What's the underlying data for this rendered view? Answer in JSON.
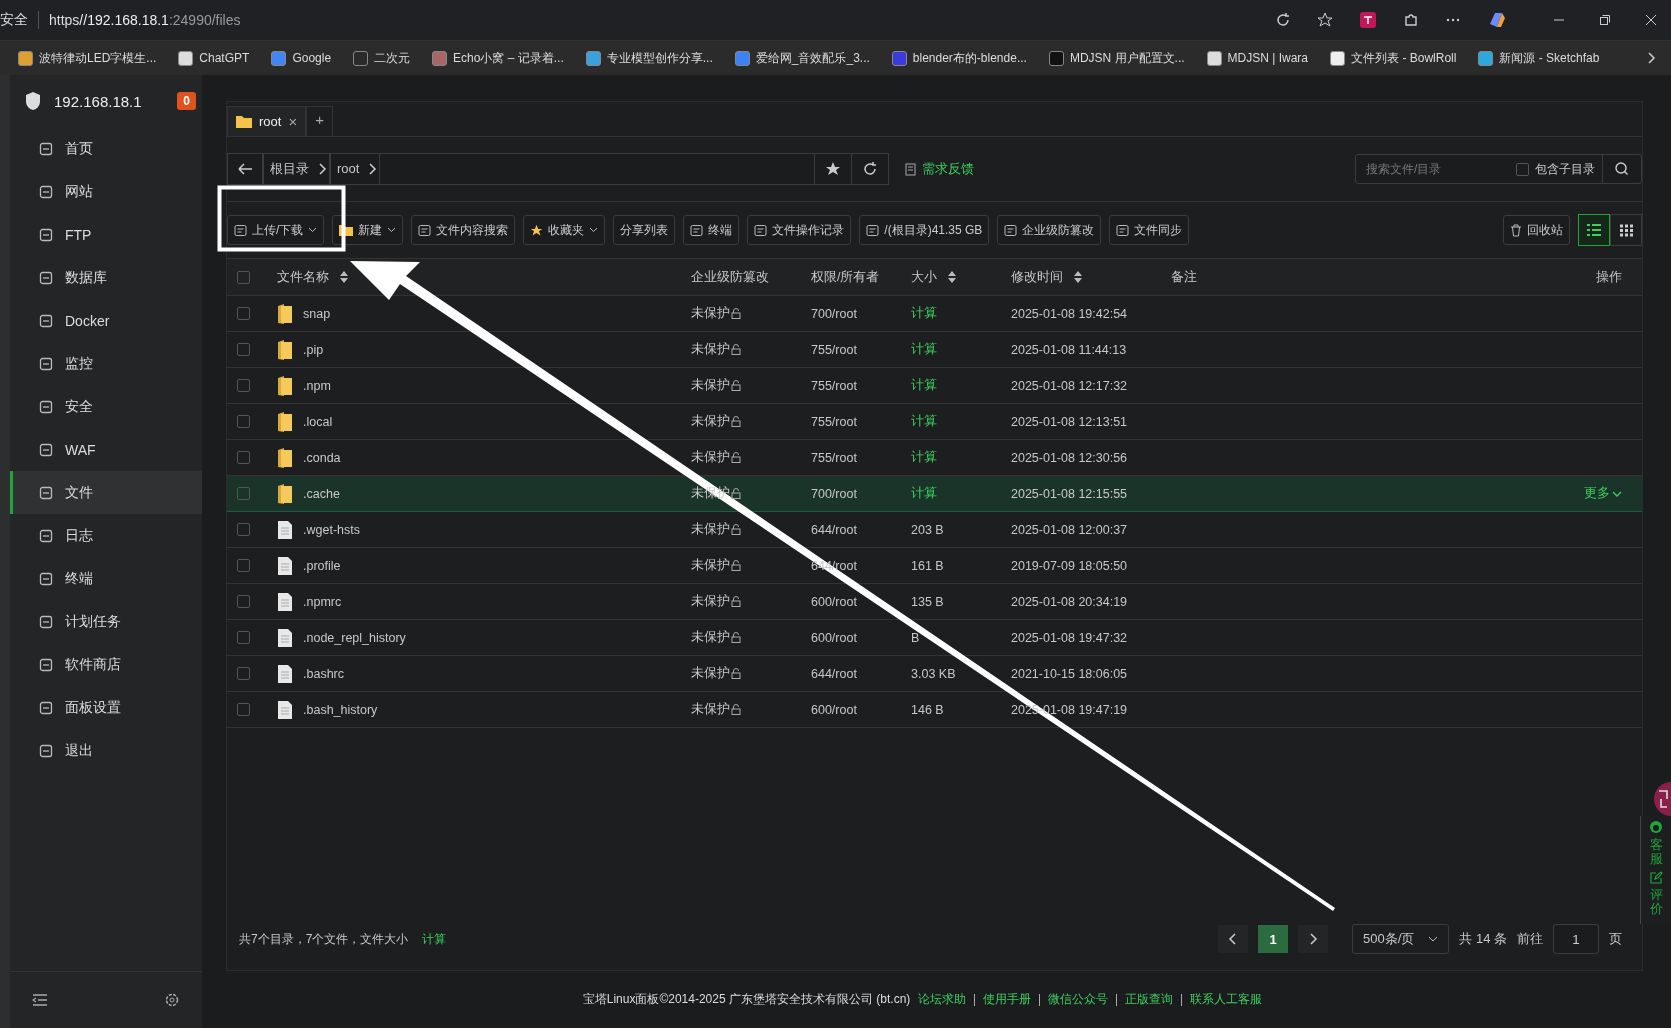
{
  "browser": {
    "security": "安全",
    "url_scheme": "https",
    "url_host": "//192.168.18.1",
    "url_rest": ":24990/files",
    "bookmarks": [
      "波特律动LED字模生...",
      "ChatGPT",
      "Google",
      "二次元",
      "Echo小窝 – 记录着...",
      "专业模型创作分享...",
      "爱给网_音效配乐_3...",
      "blender布的-blende...",
      "MDJSN 用户配置文...",
      "MDJSN | Iwara",
      "文件列表 - BowlRoll",
      "新闻源 - Sketchfab"
    ]
  },
  "sidebar": {
    "server": "192.168.18.1",
    "badge": "0",
    "items": [
      {
        "label": "首页",
        "selected": false
      },
      {
        "label": "网站",
        "selected": false
      },
      {
        "label": "FTP",
        "selected": false
      },
      {
        "label": "数据库",
        "selected": false
      },
      {
        "label": "Docker",
        "selected": false
      },
      {
        "label": "监控",
        "selected": false
      },
      {
        "label": "安全",
        "selected": false
      },
      {
        "label": "WAF",
        "selected": false
      },
      {
        "label": "文件",
        "selected": true
      },
      {
        "label": "日志",
        "selected": false
      },
      {
        "label": "终端",
        "selected": false
      },
      {
        "label": "计划任务",
        "selected": false
      },
      {
        "label": "软件商店",
        "selected": false
      },
      {
        "label": "面板设置",
        "selected": false
      },
      {
        "label": "退出",
        "selected": false
      }
    ]
  },
  "tabs": [
    {
      "label": "root",
      "selected": true,
      "close": "×"
    }
  ],
  "new_tab": "+",
  "breadcrumb": [
    "根目录",
    "root"
  ],
  "feedback": "需求反馈",
  "search": {
    "placeholder": "搜索文件/目录",
    "include_sub": "包含子目录",
    "checked": false
  },
  "toolbar": [
    {
      "label": "上传/下载",
      "dropdown": true
    },
    {
      "label": "新建",
      "dropdown": true
    },
    {
      "label": "文件内容搜索",
      "dropdown": false
    },
    {
      "label": "收藏夹",
      "dropdown": true
    },
    {
      "label": "分享列表",
      "dropdown": false
    },
    {
      "label": "终端",
      "dropdown": false
    },
    {
      "label": "文件操作记录",
      "dropdown": false
    },
    {
      "label": "/(根目录)41.35 GB",
      "dropdown": false
    },
    {
      "label": "企业级防篡改",
      "dropdown": false
    },
    {
      "label": "文件同步",
      "dropdown": false
    }
  ],
  "recycle": "回收站",
  "views": [
    {
      "kind": "list",
      "selected": true
    },
    {
      "kind": "grid",
      "selected": false
    }
  ],
  "table": {
    "select_all_checked": false,
    "columns": [
      {
        "label": "文件名称",
        "sortable": true
      },
      {
        "label": "企业级防篡改",
        "sortable": false
      },
      {
        "label": "权限/所有者",
        "sortable": false
      },
      {
        "label": "大小",
        "sortable": true
      },
      {
        "label": "修改时间",
        "sortable": true
      },
      {
        "label": "备注",
        "sortable": false
      },
      {
        "label": "操作",
        "sortable": false
      }
    ],
    "rows": [
      {
        "kind": "folder",
        "name": "snap",
        "protect": "未保护",
        "perm": "700/root",
        "size": "计算",
        "time": "2025-01-08 19:42:54",
        "checked": false,
        "selected": false
      },
      {
        "kind": "folder",
        "name": ".pip",
        "protect": "未保护",
        "perm": "755/root",
        "size": "计算",
        "time": "2025-01-08 11:44:13",
        "checked": false,
        "selected": false
      },
      {
        "kind": "folder",
        "name": ".npm",
        "protect": "未保护",
        "perm": "755/root",
        "size": "计算",
        "time": "2025-01-08 12:17:32",
        "checked": false,
        "selected": false
      },
      {
        "kind": "folder",
        "name": ".local",
        "protect": "未保护",
        "perm": "755/root",
        "size": "计算",
        "time": "2025-01-08 12:13:51",
        "checked": false,
        "selected": false
      },
      {
        "kind": "folder",
        "name": ".conda",
        "protect": "未保护",
        "perm": "755/root",
        "size": "计算",
        "time": "2025-01-08 12:30:56",
        "checked": false,
        "selected": false
      },
      {
        "kind": "folder",
        "name": ".cache",
        "protect": "未保护",
        "perm": "700/root",
        "size": "计算",
        "time": "2025-01-08 12:15:55",
        "checked": false,
        "selected": true,
        "more": "更多"
      },
      {
        "kind": "file",
        "name": ".wget-hsts",
        "protect": "未保护",
        "perm": "644/root",
        "size": "203 B",
        "time": "2025-01-08 12:00:37",
        "checked": false,
        "selected": false
      },
      {
        "kind": "file",
        "name": ".profile",
        "protect": "未保护",
        "perm": "644/root",
        "size": "161 B",
        "time": "2019-07-09 18:05:50",
        "checked": false,
        "selected": false
      },
      {
        "kind": "file",
        "name": ".npmrc",
        "protect": "未保护",
        "perm": "600/root",
        "size": "135 B",
        "time": "2025-01-08 20:34:19",
        "checked": false,
        "selected": false
      },
      {
        "kind": "file",
        "name": ".node_repl_history",
        "protect": "未保护",
        "perm": "600/root",
        "size": "B",
        "time": "2025-01-08 19:47:32",
        "checked": false,
        "selected": false
      },
      {
        "kind": "file",
        "name": ".bashrc",
        "protect": "未保护",
        "perm": "644/root",
        "size": "3.03 KB",
        "time": "2021-10-15 18:06:05",
        "checked": false,
        "selected": false
      },
      {
        "kind": "file",
        "name": ".bash_history",
        "protect": "未保护",
        "perm": "600/root",
        "size": "146 B",
        "time": "2025-01-08 19:47:19",
        "checked": false,
        "selected": false
      }
    ]
  },
  "summary": {
    "text": "共7个目录，7个文件，文件大小",
    "link": "计算"
  },
  "pagination": {
    "pages": [
      {
        "label": "1",
        "selected": true
      }
    ],
    "page_size": "500条/页",
    "total": "共 14 条",
    "goto": "前往",
    "goto_value": "1",
    "page_unit": "页"
  },
  "side_widget": [
    "客服",
    "评价"
  ],
  "footer": {
    "copyright": "宝塔Linux面板©2014-2025 广东堡塔安全技术有限公司 (bt.cn)",
    "links": [
      "论坛求助",
      "使用手册",
      "微信公众号",
      "正版查询",
      "联系人工客服"
    ]
  }
}
